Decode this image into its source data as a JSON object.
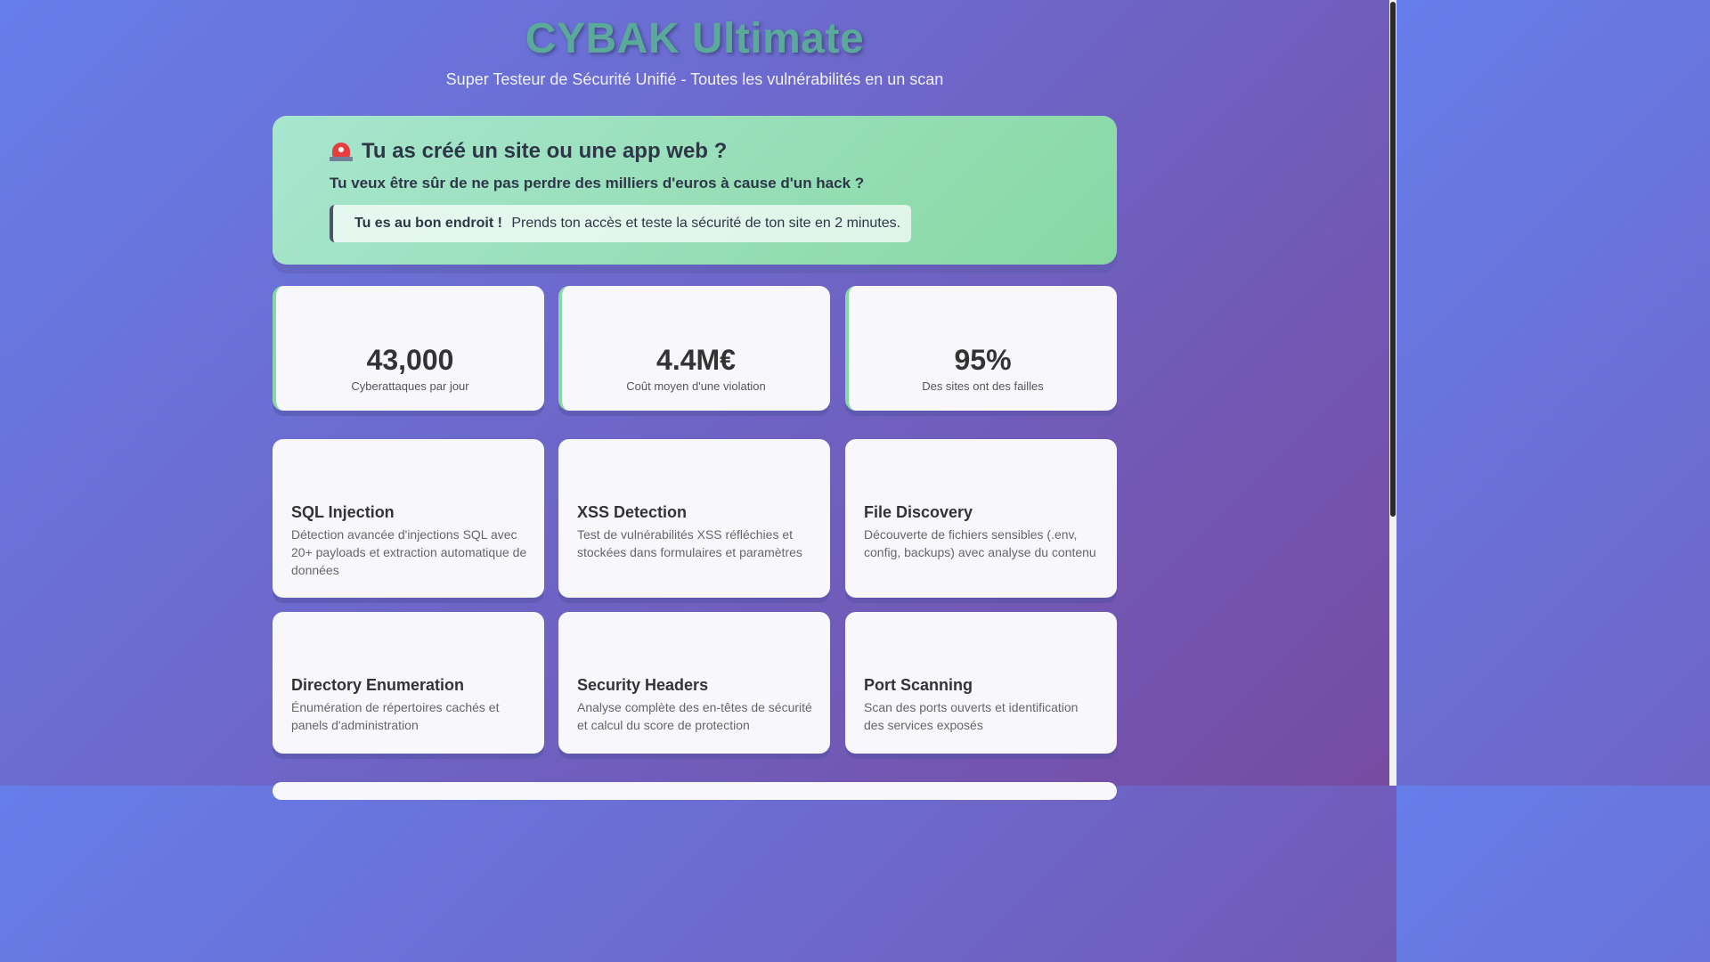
{
  "header": {
    "brand": "CYBAK Ultimate",
    "tagline": "Super Testeur de Sécurité Unifié - Toutes les vulnérabilités en un scan"
  },
  "alert": {
    "icon": "siren-icon",
    "title": "Tu as créé un site ou une app web ?",
    "subtitle": "Tu veux être sûr de ne pas perdre des milliers d'euros à cause d'un hack ?",
    "callout_strong": "Tu es au bon endroit !",
    "callout_text": "Prends ton accès et teste la sécurité de ton site en 2 minutes."
  },
  "stats": [
    {
      "value": "43,000",
      "label": "Cyberattaques par jour"
    },
    {
      "value": "4.4M€",
      "label": "Coût moyen d'une violation"
    },
    {
      "value": "95%",
      "label": "Des sites ont des failles"
    }
  ],
  "features": [
    {
      "title": "SQL Injection",
      "desc": "Détection avancée d'injections SQL avec 20+ payloads et extraction automatique de données"
    },
    {
      "title": "XSS Detection",
      "desc": "Test de vulnérabilités XSS réfléchies et stockées dans formulaires et paramètres"
    },
    {
      "title": "File Discovery",
      "desc": "Découverte de fichiers sensibles (.env, config, backups) avec analyse du contenu"
    },
    {
      "title": "Directory Enumeration",
      "desc": "Énumération de répertoires cachés et panels d'administration"
    },
    {
      "title": "Security Headers",
      "desc": "Analyse complète des en-têtes de sécurité et calcul du score de protection"
    },
    {
      "title": "Port Scanning",
      "desc": "Scan des ports ouverts et identification des services exposés"
    }
  ],
  "colors": {
    "bg_start": "#667eea",
    "bg_end": "#764ba2",
    "brand": "#5aa99a",
    "alert_start": "#a8e6cf",
    "alert_end": "#88d8a3"
  }
}
